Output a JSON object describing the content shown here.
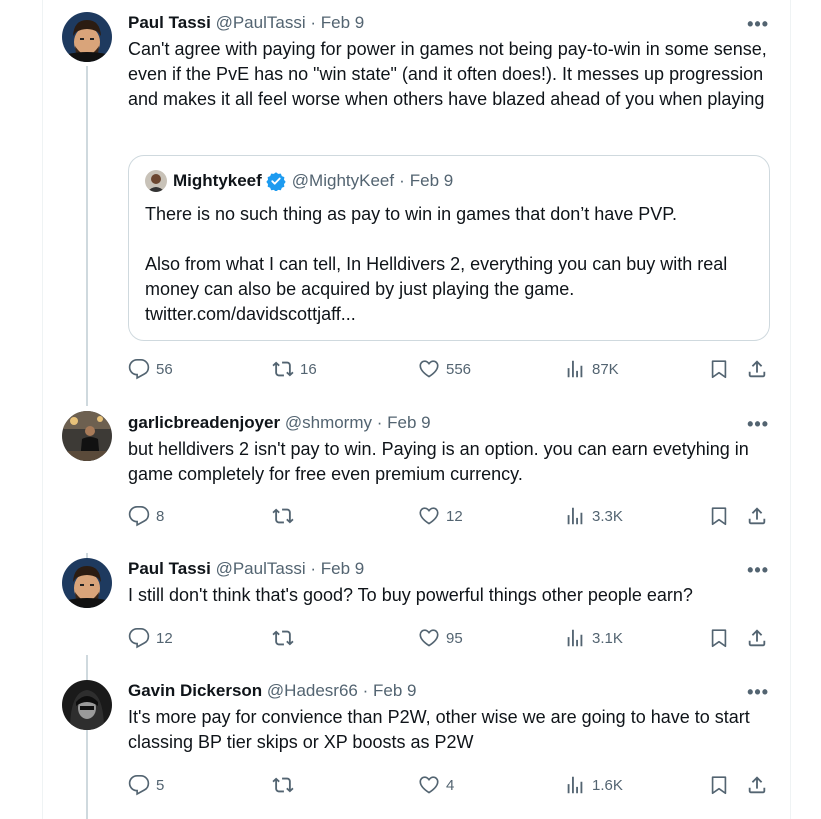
{
  "tweets": [
    {
      "name": "Paul Tassi",
      "handle": "@PaulTassi",
      "dot": "·",
      "date": "Feb 9",
      "more": "•••",
      "text": "Can't agree with paying for power in games not being pay-to-win in some sense, even if the PvE has no \"win state\" (and it often does!). It messes up progression and makes it all feel worse when others have blazed ahead of you when playing",
      "quote": {
        "name": "Mightykeef",
        "handle": "@MightyKeef",
        "dot": "·",
        "date": "Feb 9",
        "line1": "There is no such thing as pay to win in games that don’t have PVP.",
        "line2": "Also from what I can tell, In Helldivers 2, everything you can buy with real money can also be acquired by just playing the game.",
        "link": "twitter.com/davidscottjaff..."
      },
      "replies": "56",
      "retweets": "16",
      "likes": "556",
      "views": "87K"
    },
    {
      "name": "garlicbreadenjoyer",
      "handle": "@shmormy",
      "dot": "·",
      "date": "Feb 9",
      "more": "•••",
      "text": "but helldivers 2 isn't pay to win. Paying is an option. you can earn evetyhing in game completely for free even premium currency.",
      "replies": "8",
      "retweets": "",
      "likes": "12",
      "views": "3.3K"
    },
    {
      "name": "Paul Tassi",
      "handle": "@PaulTassi",
      "dot": "·",
      "date": "Feb 9",
      "more": "•••",
      "text": "I still don't think that's good? To buy powerful things other people earn?",
      "replies": "12",
      "retweets": "",
      "likes": "95",
      "views": "3.1K"
    },
    {
      "name": "Gavin Dickerson",
      "handle": "@Hadesr66",
      "dot": "·",
      "date": "Feb 9",
      "more": "•••",
      "text": "It's more pay for convience than P2W, other wise we are going to have to start classing BP tier skips or XP boosts as P2W",
      "replies": "5",
      "retweets": "",
      "likes": "4",
      "views": "1.6K"
    }
  ],
  "icons": {
    "reply": "reply-icon",
    "retweet": "retweet-icon",
    "like": "heart-icon",
    "views": "views-icon",
    "bookmark": "bookmark-icon",
    "share": "share-icon",
    "verified": "verified-badge-icon"
  },
  "colors": {
    "text": "#0f1419",
    "secondary": "#536471",
    "border": "#cfd9de",
    "verified": "#1d9bf0"
  }
}
